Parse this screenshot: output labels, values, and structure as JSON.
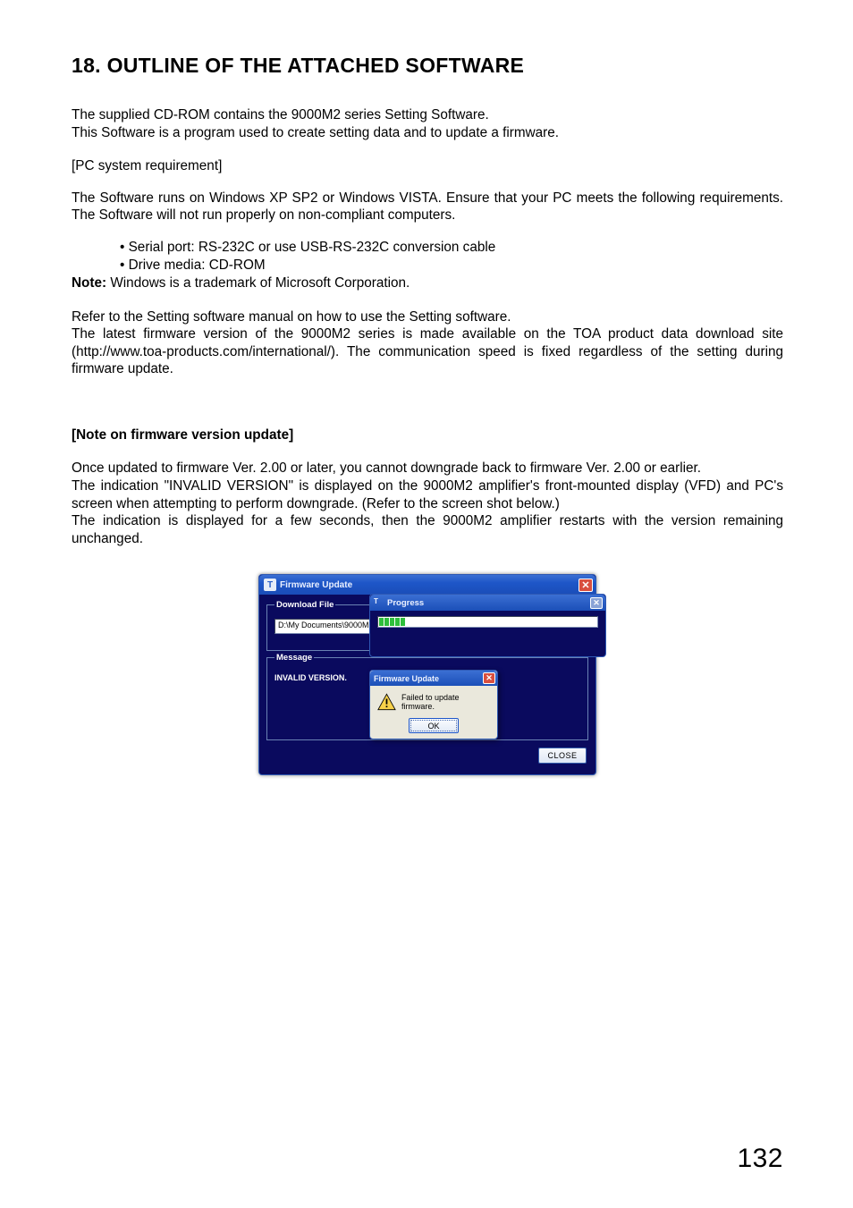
{
  "heading": "18. OUTLINE OF THE ATTACHED SOFTWARE",
  "p1_l1": "The supplied CD-ROM contains the 9000M2 series Setting Software.",
  "p1_l2": "This Software is a program used to create setting data and to update a firmware.",
  "pc_req_label": "[PC system requirement]",
  "p2": "The Software runs on Windows XP SP2 or Windows VISTA. Ensure that your PC meets the following requirements. The Software will not run properly on non-compliant computers.",
  "bullet1": "• Serial port:    RS-232C or use USB-RS-232C conversion cable",
  "bullet2": "• Drive media: CD-ROM",
  "note_b": "Note:",
  "note_t": " Windows is a trademark of Microsoft Corporation.",
  "p3_l1": "Refer to the Setting software manual on how to use the Setting software.",
  "p3_rest": "The latest firmware version of the 9000M2 series is made available on the TOA product data download site (http://www.toa-products.com/international/). The communication speed is fixed regardless of the setting during firmware update.",
  "note2_title": "[Note on firmware version update]",
  "p4_l1": "Once updated to firmware Ver. 2.00 or later, you cannot downgrade back to firmware Ver. 2.00 or earlier.",
  "p4_l2": "The indication \"INVALID VERSION\" is displayed on the 9000M2 amplifier's front-mounted display (VFD) and PC's screen when attempting to perform downgrade. (Refer to the screen shot below.)",
  "p4_l3": "The indication is displayed for a few seconds, then the 9000M2 amplifier restarts with the version remaining unchanged.",
  "page_number": "132",
  "dialog": {
    "outer_title": "Firmware Update",
    "group_download": "Download File",
    "download_path": "D:\\My Documents\\9000M2\\90",
    "group_message": "Message",
    "message_text": "INVALID VERSION.",
    "close_btn": "CLOSE",
    "progress_title": "Progress",
    "alert_title": "Firmware Update",
    "alert_text": "Failed to update firmware.",
    "alert_ok": "OK",
    "close_x": "✕"
  }
}
